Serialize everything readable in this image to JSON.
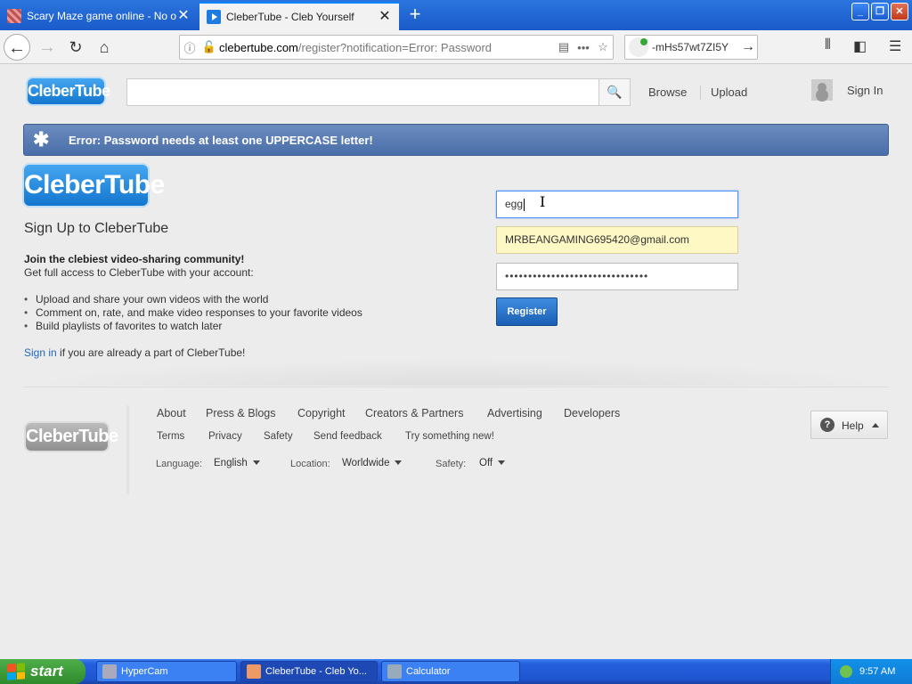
{
  "browser": {
    "tabs": [
      {
        "title": "Scary Maze game online - No over",
        "active": false
      },
      {
        "title": "CleberTube - Cleb Yourself",
        "active": true
      }
    ],
    "url": {
      "host": "clebertube.com",
      "rest": "/register?notification=Error: Password"
    },
    "search_value": "-mHs57wt7ZI5Y"
  },
  "site": {
    "logo_text": "CleberTube",
    "search_placeholder": "",
    "nav": {
      "browse": "Browse",
      "upload": "Upload",
      "sign_in": "Sign In"
    }
  },
  "alert": {
    "message": "Error: Password needs at least one UPPERCASE letter!"
  },
  "signup": {
    "title": "Sign Up to CleberTube",
    "join": "Join the clebiest video-sharing community!",
    "access": "Get full access to CleberTube with your account:",
    "features": [
      "Upload and share your own videos with the world",
      "Comment on, rate, and make video responses to your favorite videos",
      "Build playlists of favorites to watch later"
    ],
    "signin_link": "Sign in",
    "signin_rest": " if you are already a part of CleberTube!"
  },
  "form": {
    "username": "egg",
    "email": "MRBEANGAMING695420@gmail.com",
    "password_mask": "•••••••••••••••••••••••••••••••",
    "register_label": "Register"
  },
  "footer": {
    "links_row1": [
      "About",
      "Press & Blogs",
      "Copyright",
      "Creators & Partners",
      "Advertising",
      "Developers"
    ],
    "links_row2": [
      "Terms",
      "Privacy",
      "Safety",
      "Send feedback",
      "Try something new!"
    ],
    "language_label": "Language:",
    "language_value": "English",
    "location_label": "Location:",
    "location_value": "Worldwide",
    "safety_label": "Safety:",
    "safety_value": "Off",
    "help_label": "Help"
  },
  "taskbar": {
    "start": "start",
    "tasks": [
      "HyperCam",
      "CleberTube - Cleb Yo...",
      "Calculator"
    ],
    "clock": "9:57 AM"
  },
  "colors": {
    "brand_blue": "#1376cf",
    "alert_bg": "#4a6ea9",
    "autofill_yellow": "#fdf8c4",
    "register_blue": "#1b5fb5"
  }
}
